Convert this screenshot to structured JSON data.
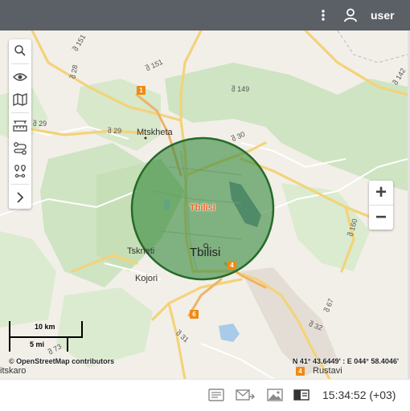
{
  "topbar": {
    "menu_icon": "vertical-dots-icon",
    "user_icon": "user-icon",
    "username": "user"
  },
  "toolbar": {
    "items": [
      {
        "name": "search-icon"
      },
      {
        "name": "eye-icon"
      },
      {
        "name": "map-icon"
      },
      {
        "name": "ruler-icon"
      },
      {
        "name": "route-icon"
      },
      {
        "name": "waypoints-icon"
      },
      {
        "name": "chevron-right-icon"
      }
    ]
  },
  "zoom": {
    "in": "+",
    "out": "−"
  },
  "map": {
    "places": {
      "mtskheta": "Mtskheta",
      "tbilisi": "Tbilisi",
      "tskneti": "Tskneti",
      "kojori": "Kojori",
      "rustavi": "Rustavi",
      "tsiskaro": "itskaro"
    },
    "roads": [
      "შ 151",
      "შ 28",
      "შ 151",
      "შ 149",
      "შ 142",
      "შ 29",
      "შ 29",
      "შ 30",
      "შ 160",
      "შ 67",
      "შ 32",
      "შ 31",
      "შ 73"
    ],
    "shields": [
      "1",
      "4",
      "6",
      "4"
    ],
    "geozone": {
      "label": "Tbilisi",
      "fill": "#3a8a3f",
      "stroke": "#256b2a"
    },
    "scale": {
      "km": "10 km",
      "mi": "5 mi"
    },
    "attribution": "© OpenStreetMap contributors",
    "coordinates": "N 41° 43.6449' : E 044° 58.4046'"
  },
  "bottombar": {
    "icons": [
      "messages-icon",
      "send-message-icon",
      "image-icon",
      "panel-icon"
    ],
    "time": "15:34:52 (+03)"
  }
}
